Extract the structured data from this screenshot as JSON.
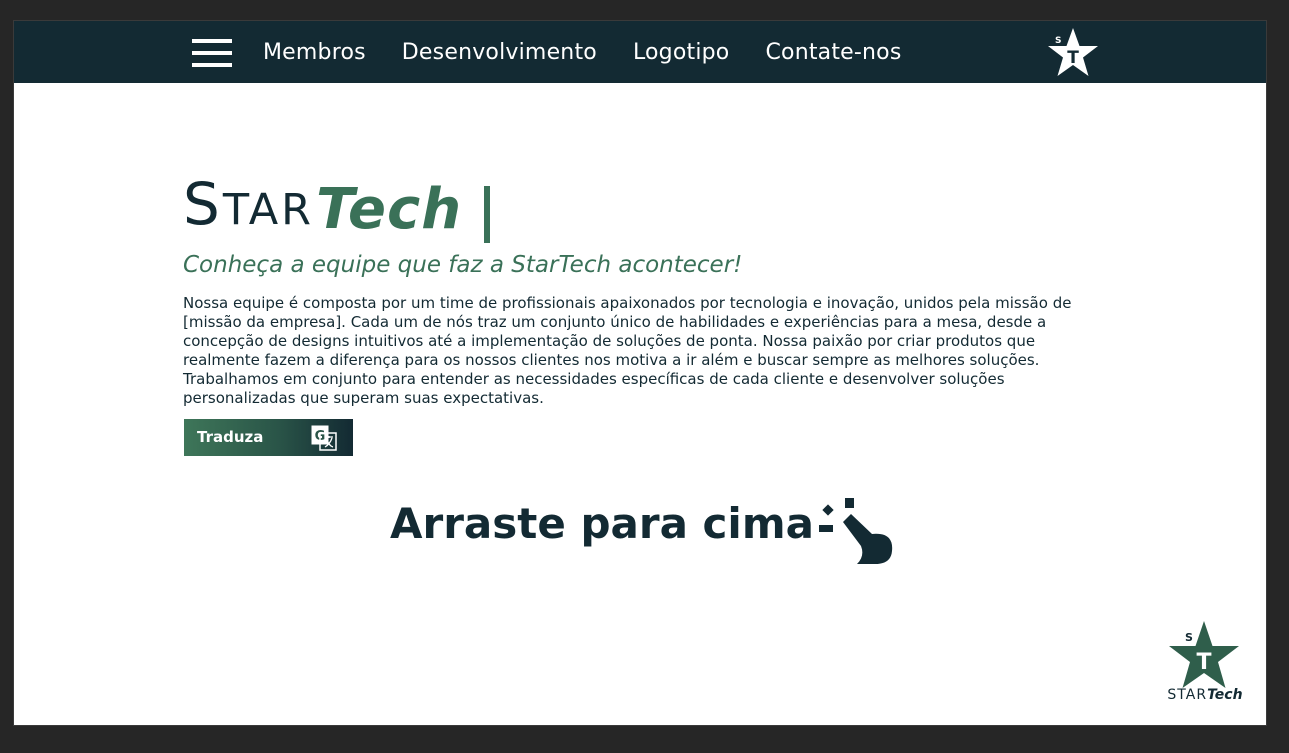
{
  "nav": {
    "links": [
      "Membros",
      "Desenvolvimento",
      "Logotipo",
      "Contate-nos"
    ]
  },
  "brand": {
    "star_text_big": "S",
    "star_text_rest": "TAR",
    "tech_text": "Tech"
  },
  "hero": {
    "tagline": "Conheça a equipe que faz a StarTech acontecer!",
    "description": "Nossa equipe é composta por um time de profissionais apaixonados por tecnologia e inovação, unidos pela missão de [missão da empresa]. Cada um de nós traz um conjunto único de habilidades e experiências para a mesa, desde a concepção de designs intuitivos até a implementação de soluções de ponta. Nossa paixão por criar produtos que realmente fazem a diferença para os nossos clientes nos motiva a ir além e buscar sempre as melhores soluções. Trabalhamos em conjunto para entender as necessidades específicas de cada cliente e desenvolver soluções personalizadas que superam suas expectativas.",
    "translate_label": "Traduza",
    "swipe_label": "Arraste para cima"
  },
  "logo": {
    "star_letter": "S",
    "star_inner": "T",
    "corner_star_text": "STAR",
    "corner_tech_text": "Tech"
  },
  "icons": {
    "menu": "hamburger-icon",
    "nav_logo": "star-logo-icon",
    "theme": "moon-icon",
    "translate": "google-translate-icon",
    "swipe": "swipe-up-hand-icon",
    "corner_logo": "star-logo-icon"
  },
  "colors": {
    "navbar": "#132a33",
    "primary_dark": "#132a33",
    "accent_green": "#3a7158",
    "page_bg": "#ffffff",
    "outer_bg": "#262626"
  }
}
